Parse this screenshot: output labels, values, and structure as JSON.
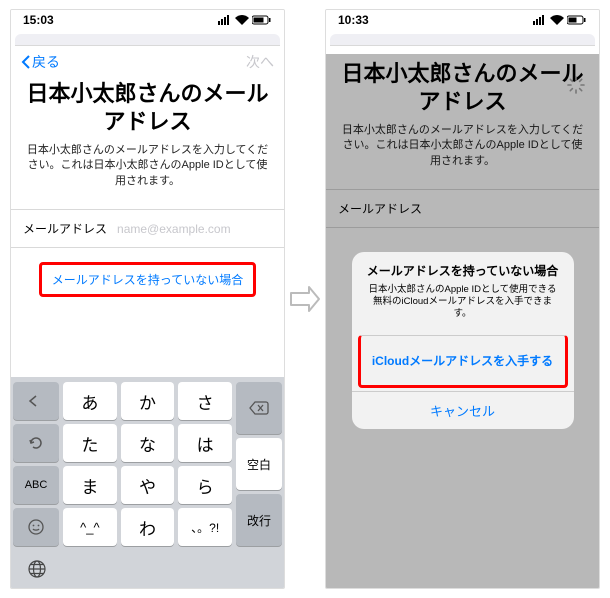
{
  "leftPhone": {
    "status": {
      "time": "15:03",
      "signal": "▮▮▮▮",
      "wifi": "wifi",
      "battery": "batt"
    },
    "nav": {
      "back": "戻る",
      "next": "次へ"
    },
    "title": "日本小太郎さんのメールアドレス",
    "subtext": "日本小太郎さんのメールアドレスを入力してください。これは日本小太郎さんのApple IDとして使用されます。",
    "form": {
      "label": "メールアドレス",
      "placeholder": "name@example.com"
    },
    "link": "メールアドレスを持っていない場合",
    "keyboard": {
      "rows": [
        [
          "あ",
          "か",
          "さ"
        ],
        [
          "た",
          "な",
          "は"
        ],
        [
          "ま",
          "や",
          "ら"
        ],
        [
          "^_^",
          "わ",
          "、。?!"
        ]
      ],
      "left": [
        "←",
        "↺",
        "ABC",
        "☺"
      ],
      "right": [
        "⌫",
        "空白",
        "改行"
      ],
      "globe": "🌐"
    }
  },
  "rightPhone": {
    "status": {
      "time": "10:33"
    },
    "title": "日本小太郎さんのメールアドレス",
    "subtext": "日本小太郎さんのメールアドレスを入力してください。これは日本小太郎さんのApple IDとして使用されます。",
    "form": {
      "label": "メールアドレス"
    },
    "alert": {
      "title": "メールアドレスを持っていない場合",
      "body": "日本小太郎さんのApple IDとして使用できる無料のiCloudメールアドレスを入手できます。",
      "action": "iCloudメールアドレスを入手する",
      "cancel": "キャンセル"
    }
  }
}
